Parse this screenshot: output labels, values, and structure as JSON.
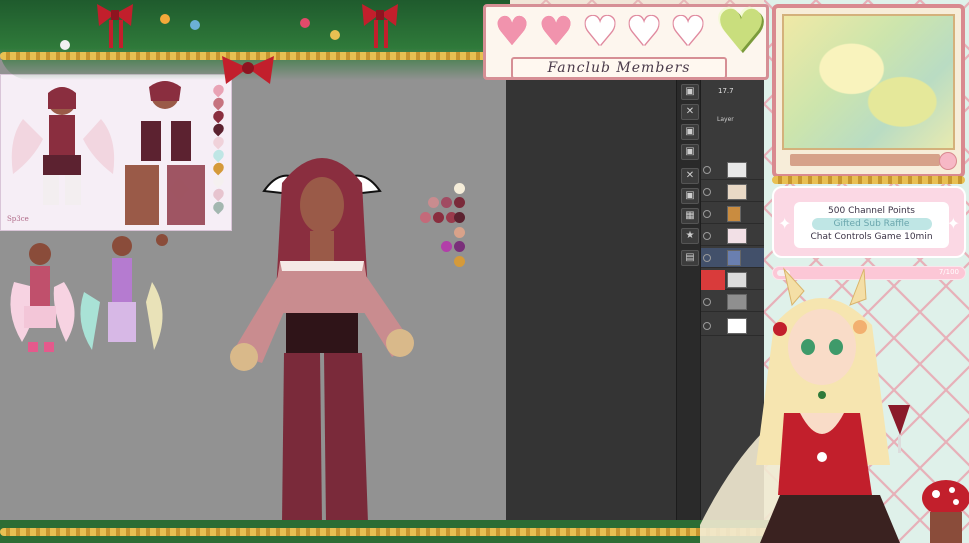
{
  "overlay": {
    "banner_title": "Fanclub Members",
    "hearts": [
      {
        "state": "filled"
      },
      {
        "state": "filled"
      },
      {
        "state": "empty"
      },
      {
        "state": "empty"
      },
      {
        "state": "empty"
      }
    ],
    "big_heart_icon": "heart-icon",
    "rewards": [
      {
        "label": "500 Channel Points",
        "highlight": false
      },
      {
        "label": "Gifted Sub Raffle",
        "highlight": true
      },
      {
        "label": "Chat Controls Game 10min",
        "highlight": false
      }
    ],
    "goal": {
      "text": "7/100",
      "progress": 0.07
    }
  },
  "app": {
    "brush_size": "17.7",
    "layer_panel_title": "Layer",
    "tool_icons": [
      "camera-icon",
      "close-icon",
      "camera-icon",
      "camera-icon",
      "close-icon",
      "camera-icon",
      "image-icon",
      "star-icon",
      "portrait-icon"
    ]
  },
  "ref_sheet": {
    "artist_signature": "Sp3ce"
  },
  "palette": {
    "colors": [
      "#f5edd9",
      "#c98c8f",
      "#a14b62",
      "#7a2a3a",
      "#c46a7a",
      "#8a2e3f",
      "#5c2230",
      "#e6c3b2",
      "#d9a28a",
      "#b23fa9",
      "#7a2f7a",
      "#d59a3a"
    ]
  },
  "colors": {
    "canvas": "#929292",
    "workspace": "#343434",
    "garland": "#2d6d34",
    "heart_pink": "#f193ad",
    "green_heart": "#c9de7d",
    "accent_pink": "#fbd8e4",
    "highlight_teal": "#bfe6e5"
  }
}
